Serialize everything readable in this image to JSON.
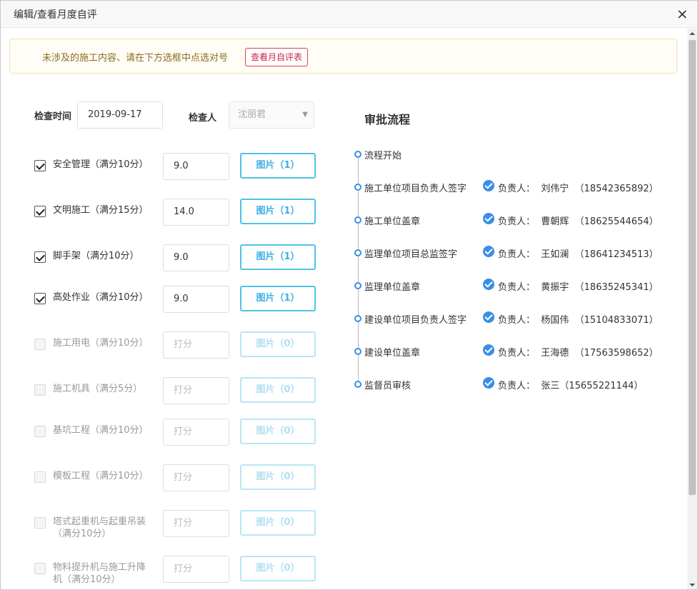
{
  "dialog": {
    "title": "编辑/查看月度自评"
  },
  "notice": {
    "text": "未涉及的施工内容、请在下方选框中点选对号",
    "button": "查看月自评表"
  },
  "form": {
    "date_label": "检查时间",
    "date_value": "2019-09-17",
    "inspector_label": "检查人",
    "inspector_value": "沈丽君"
  },
  "items": [
    {
      "label": "安全管理（满分10分）",
      "checked": true,
      "score": "9.0",
      "images": "图片（1）"
    },
    {
      "label": "文明施工（满分15分）",
      "checked": true,
      "score": "14.0",
      "images": "图片（1）"
    },
    {
      "label": "脚手架（满分10分）",
      "checked": true,
      "score": "9.0",
      "images": "图片（1）"
    },
    {
      "label": "高处作业（满分10分）",
      "checked": true,
      "score": "9.0",
      "images": "图片（1）"
    },
    {
      "label": "施工用电（满分10分）",
      "checked": false,
      "score": "打分",
      "images": "图片（0）"
    },
    {
      "label": "施工机具（满分5分）",
      "checked": false,
      "score": "打分",
      "images": "图片（0）"
    },
    {
      "label": "基坑工程（满分10分）",
      "checked": false,
      "score": "打分",
      "images": "图片（0）"
    },
    {
      "label": "模板工程（满分10分）",
      "checked": false,
      "score": "打分",
      "images": "图片（0）"
    },
    {
      "label": "塔式起重机与起重吊装（满分10分）",
      "checked": false,
      "score": "打分",
      "images": "图片（0）"
    },
    {
      "label": "物料提升机与施工升降机（满分10分）",
      "checked": false,
      "score": "打分",
      "images": "图片（0）"
    }
  ],
  "flow": {
    "title": "审批流程",
    "steps": [
      {
        "name": "流程开始",
        "owner": ""
      },
      {
        "name": "施工单位项目负责人签字",
        "owner": "负责人：  刘伟宁  （18542365892）"
      },
      {
        "name": "施工单位盖章",
        "owner": "负责人：  曹朝辉  （18625544654）"
      },
      {
        "name": "监理单位项目总监签字",
        "owner": "负责人：  王如澜  （18641234513）"
      },
      {
        "name": "监理单位盖章",
        "owner": "负责人：  黄振宇  （18635245341）"
      },
      {
        "name": "建设单位项目负责人签字",
        "owner": "负责人：  杨国伟  （15104833071）"
      },
      {
        "name": "建设单位盖章",
        "owner": "负责人：  王海德  （17563598652）"
      },
      {
        "name": "监督员审核",
        "owner": "负责人：  张三（15655221144）"
      }
    ]
  },
  "colors": {
    "accent": "#3a8ee6",
    "image_button": "#4fc3e8",
    "notice_button": "#d9434d"
  }
}
